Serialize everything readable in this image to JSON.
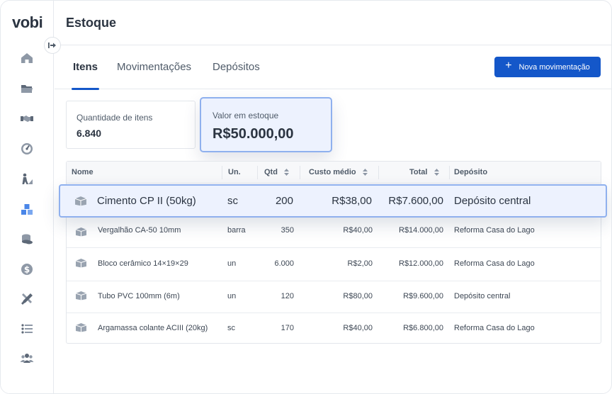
{
  "app": {
    "logo": "vobi"
  },
  "sidebar": {
    "items": [
      {
        "icon": "home-icon"
      },
      {
        "icon": "folder-icon"
      },
      {
        "icon": "handshake-icon"
      },
      {
        "icon": "dashboard-icon"
      },
      {
        "icon": "worker-icon"
      },
      {
        "icon": "boxes-icon"
      },
      {
        "icon": "coins-icon"
      },
      {
        "icon": "dollar-icon"
      },
      {
        "icon": "tools-icon"
      },
      {
        "icon": "list-icon"
      },
      {
        "icon": "users-icon"
      }
    ]
  },
  "header": {
    "title": "Estoque"
  },
  "tabs": [
    {
      "label": "Itens",
      "active": true
    },
    {
      "label": "Movimentações",
      "active": false
    },
    {
      "label": "Depósitos",
      "active": false
    }
  ],
  "actions": {
    "new_movement": "Nova movimentação"
  },
  "stats": {
    "quantity": {
      "label": "Quantidade de itens",
      "value": "6.840"
    },
    "stock_value": {
      "label": "Valor em estoque",
      "value": "R$50.000,00"
    }
  },
  "table": {
    "headers": {
      "name": "Nome",
      "unit": "Un.",
      "qty": "Qtd",
      "avg_cost": "Custo médio",
      "total": "Total",
      "deposit": "Depósito"
    },
    "rows": [
      {
        "name": "Cimento CP II (50kg)",
        "unit": "sc",
        "qty": "200",
        "avg_cost": "R$38,00",
        "total": "R$7.600,00",
        "deposit": "Depósito central"
      },
      {
        "name": "Vergalhão CA-50 10mm",
        "unit": "barra",
        "qty": "350",
        "avg_cost": "R$40,00",
        "total": "R$14.000,00",
        "deposit": "Reforma Casa do Lago"
      },
      {
        "name": "Bloco cerâmico 14×19×29",
        "unit": "un",
        "qty": "6.000",
        "avg_cost": "R$2,00",
        "total": "R$12.000,00",
        "deposit": "Reforma Casa do Lago"
      },
      {
        "name": "Tubo PVC 100mm (6m)",
        "unit": "un",
        "qty": "120",
        "avg_cost": "R$80,00",
        "total": "R$9.600,00",
        "deposit": "Depósito central"
      },
      {
        "name": "Argamassa colante ACIII (20kg)",
        "unit": "sc",
        "qty": "170",
        "avg_cost": "R$40,00",
        "total": "R$6.800,00",
        "deposit": "Reforma Casa do Lago"
      }
    ]
  },
  "colors": {
    "accent": "#1457c9",
    "highlight_bg": "#edf2fe",
    "highlight_border": "#8fb0ee"
  }
}
